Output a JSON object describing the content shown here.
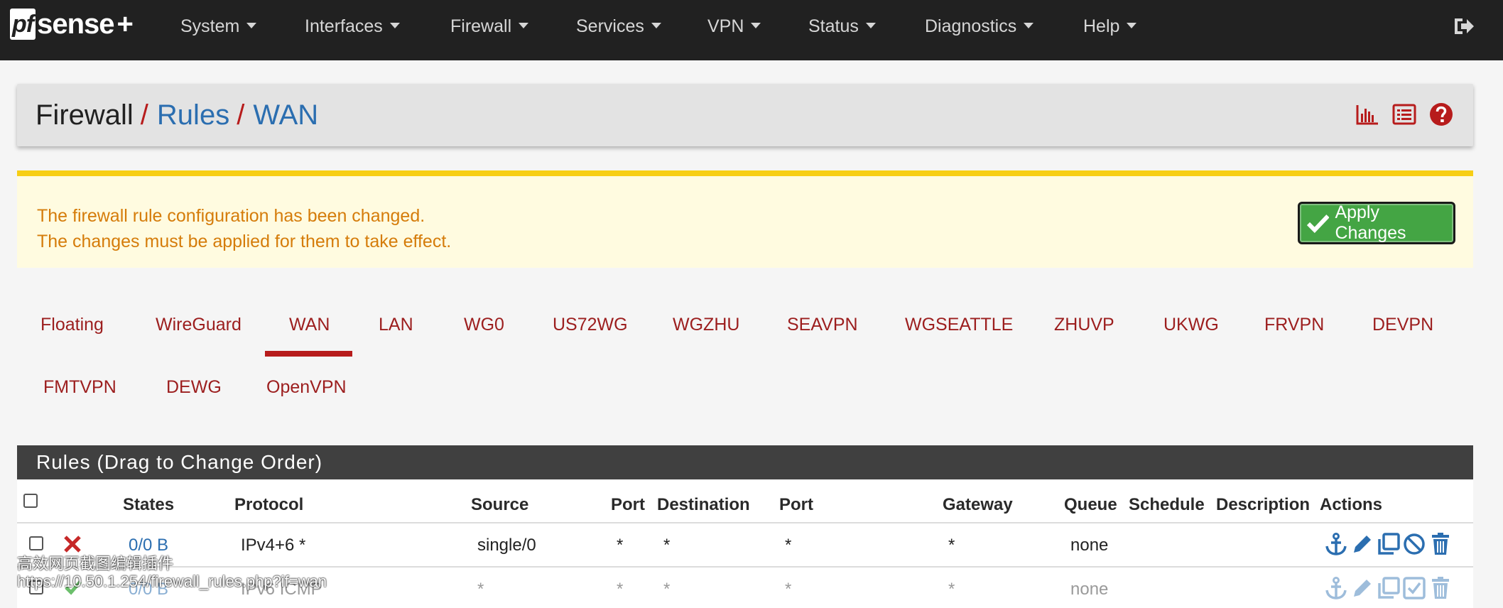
{
  "navbar": {
    "logo": {
      "pf": "pf",
      "sense": "sense",
      "plus": "+"
    },
    "items": [
      "System",
      "Interfaces",
      "Firewall",
      "Services",
      "VPN",
      "Status",
      "Diagnostics",
      "Help"
    ]
  },
  "breadcrumb": {
    "part1": "Firewall",
    "sep": "/",
    "part2": "Rules",
    "part3": "WAN"
  },
  "alert": {
    "line1": "The firewall rule configuration has been changed.",
    "line2": "The changes must be applied for them to take effect.",
    "button": "Apply Changes"
  },
  "tabs": {
    "row1": [
      "Floating",
      "WireGuard",
      "WAN",
      "LAN",
      "WG0",
      "US72WG",
      "WGZHU",
      "SEAVPN",
      "WGSEATTLE",
      "ZHUVP",
      "UKWG",
      "FRVPN",
      "DEVPN"
    ],
    "row2": [
      "FMTVPN",
      "DEWG",
      "OpenVPN"
    ],
    "active": "WAN"
  },
  "rules": {
    "title": "Rules (Drag to Change Order)",
    "columns": [
      "States",
      "Protocol",
      "Source",
      "Port",
      "Destination",
      "Port",
      "Gateway",
      "Queue",
      "Schedule",
      "Description",
      "Actions"
    ],
    "rows": [
      {
        "states": "0/0 B",
        "protocol": "IPv4+6 *",
        "source": "single/0",
        "port": "*",
        "destination": "*",
        "dport": "*",
        "gateway": "*",
        "queue": "none",
        "status": "block"
      },
      {
        "states": "0/0 B",
        "protocol": "IPv6 ICMP",
        "source": "*",
        "port": "*",
        "destination": "*",
        "dport": "*",
        "gateway": "*",
        "queue": "none",
        "status": "pass"
      }
    ]
  },
  "watermark": {
    "line1": "高效网页截图编辑插件",
    "line2": "https://10.50.1.254/firewall_rules.php?if=wan"
  },
  "colors": {
    "navbar": "#212121",
    "accent_red": "#b71c1c",
    "link_blue": "#2b6eb0",
    "apply_green": "#44a544",
    "alert_bg": "#fffbe0",
    "alert_border": "#f7ce14"
  }
}
